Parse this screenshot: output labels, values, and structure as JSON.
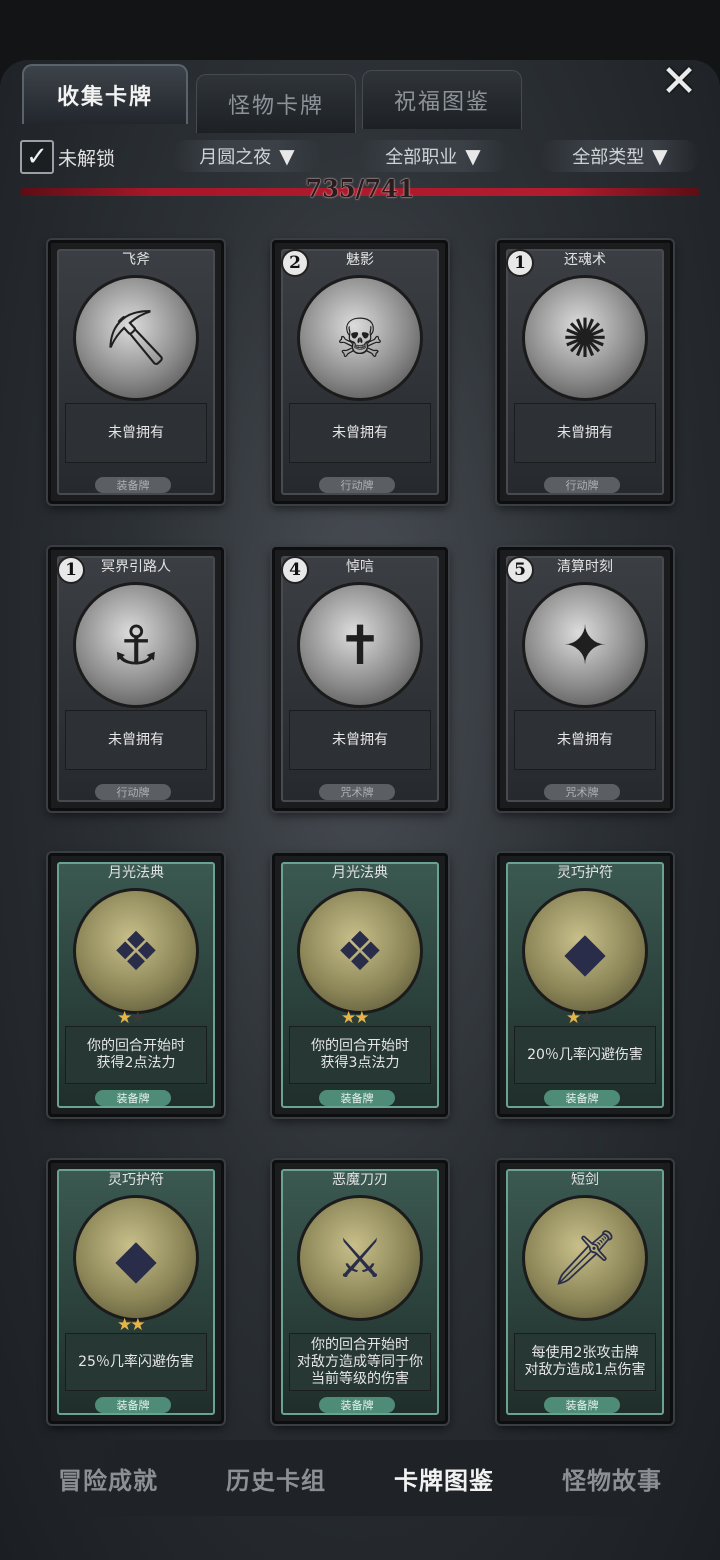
{
  "tabs": [
    {
      "label": "收集卡牌",
      "active": true
    },
    {
      "label": "怪物卡牌",
      "active": false
    },
    {
      "label": "祝福图鉴",
      "active": false
    }
  ],
  "close_icon": "close-x-icon",
  "filters": {
    "unlocked_checked": true,
    "unlocked_label": "未解锁",
    "dropdowns": [
      {
        "label": "月圆之夜",
        "icon": "funnel-icon"
      },
      {
        "label": "全部职业",
        "icon": "funnel-icon"
      },
      {
        "label": "全部类型",
        "icon": "funnel-icon"
      }
    ]
  },
  "progress": {
    "text": "735/741",
    "fraction": 0.992
  },
  "cards": [
    {
      "title": "飞斧",
      "cost": "",
      "art_icon": "axe-icon",
      "desc": "未曾拥有",
      "type": "装备牌",
      "style": "gray",
      "stars": []
    },
    {
      "title": "魅影",
      "cost": "2",
      "art_icon": "phantom-icon",
      "desc": "未曾拥有",
      "type": "行动牌",
      "style": "gray",
      "stars": []
    },
    {
      "title": "还魂术",
      "cost": "1",
      "art_icon": "revive-icon",
      "desc": "未曾拥有",
      "type": "行动牌",
      "style": "gray",
      "stars": []
    },
    {
      "title": "冥界引路人",
      "cost": "1",
      "art_icon": "ferryman-icon",
      "desc": "未曾拥有",
      "type": "行动牌",
      "style": "gray",
      "stars": []
    },
    {
      "title": "悼唁",
      "cost": "4",
      "art_icon": "mourning-nun-icon",
      "desc": "未曾拥有",
      "type": "咒术牌",
      "style": "gray",
      "stars": []
    },
    {
      "title": "清算时刻",
      "cost": "5",
      "art_icon": "sword-light-icon",
      "desc": "未曾拥有",
      "type": "咒术牌",
      "style": "gray",
      "stars": []
    },
    {
      "title": "月光法典",
      "cost": "",
      "art_icon": "spellbook-icon",
      "desc": "你的回合开始时\n获得2点法力",
      "type": "装备牌",
      "style": "green",
      "stars": [
        1,
        0
      ]
    },
    {
      "title": "月光法典",
      "cost": "",
      "art_icon": "spellbook-icon",
      "desc": "你的回合开始时\n获得3点法力",
      "type": "装备牌",
      "style": "green",
      "stars": [
        1,
        1
      ]
    },
    {
      "title": "灵巧护符",
      "cost": "",
      "art_icon": "amulet-icon",
      "desc": "20％几率闪避伤害",
      "type": "装备牌",
      "style": "green",
      "stars": [
        1,
        0
      ]
    },
    {
      "title": "灵巧护符",
      "cost": "",
      "art_icon": "amulet-icon",
      "desc": "25％几率闪避伤害",
      "type": "装备牌",
      "style": "green",
      "stars": [
        1,
        1
      ]
    },
    {
      "title": "恶魔刀刃",
      "cost": "",
      "art_icon": "demon-blade-icon",
      "desc": "你的回合开始时\n对敌方造成等同于你\n当前等级的伤害",
      "type": "装备牌",
      "style": "green",
      "stars": []
    },
    {
      "title": "短剑",
      "cost": "",
      "art_icon": "dagger-icon",
      "desc": "每使用2张攻击牌\n对敌方造成1点伤害",
      "type": "装备牌",
      "style": "green",
      "stars": []
    }
  ],
  "bottom_nav": [
    {
      "label": "冒险成就",
      "active": false
    },
    {
      "label": "历史卡组",
      "active": false
    },
    {
      "label": "卡牌图鉴",
      "active": true
    },
    {
      "label": "怪物故事",
      "active": false
    }
  ]
}
